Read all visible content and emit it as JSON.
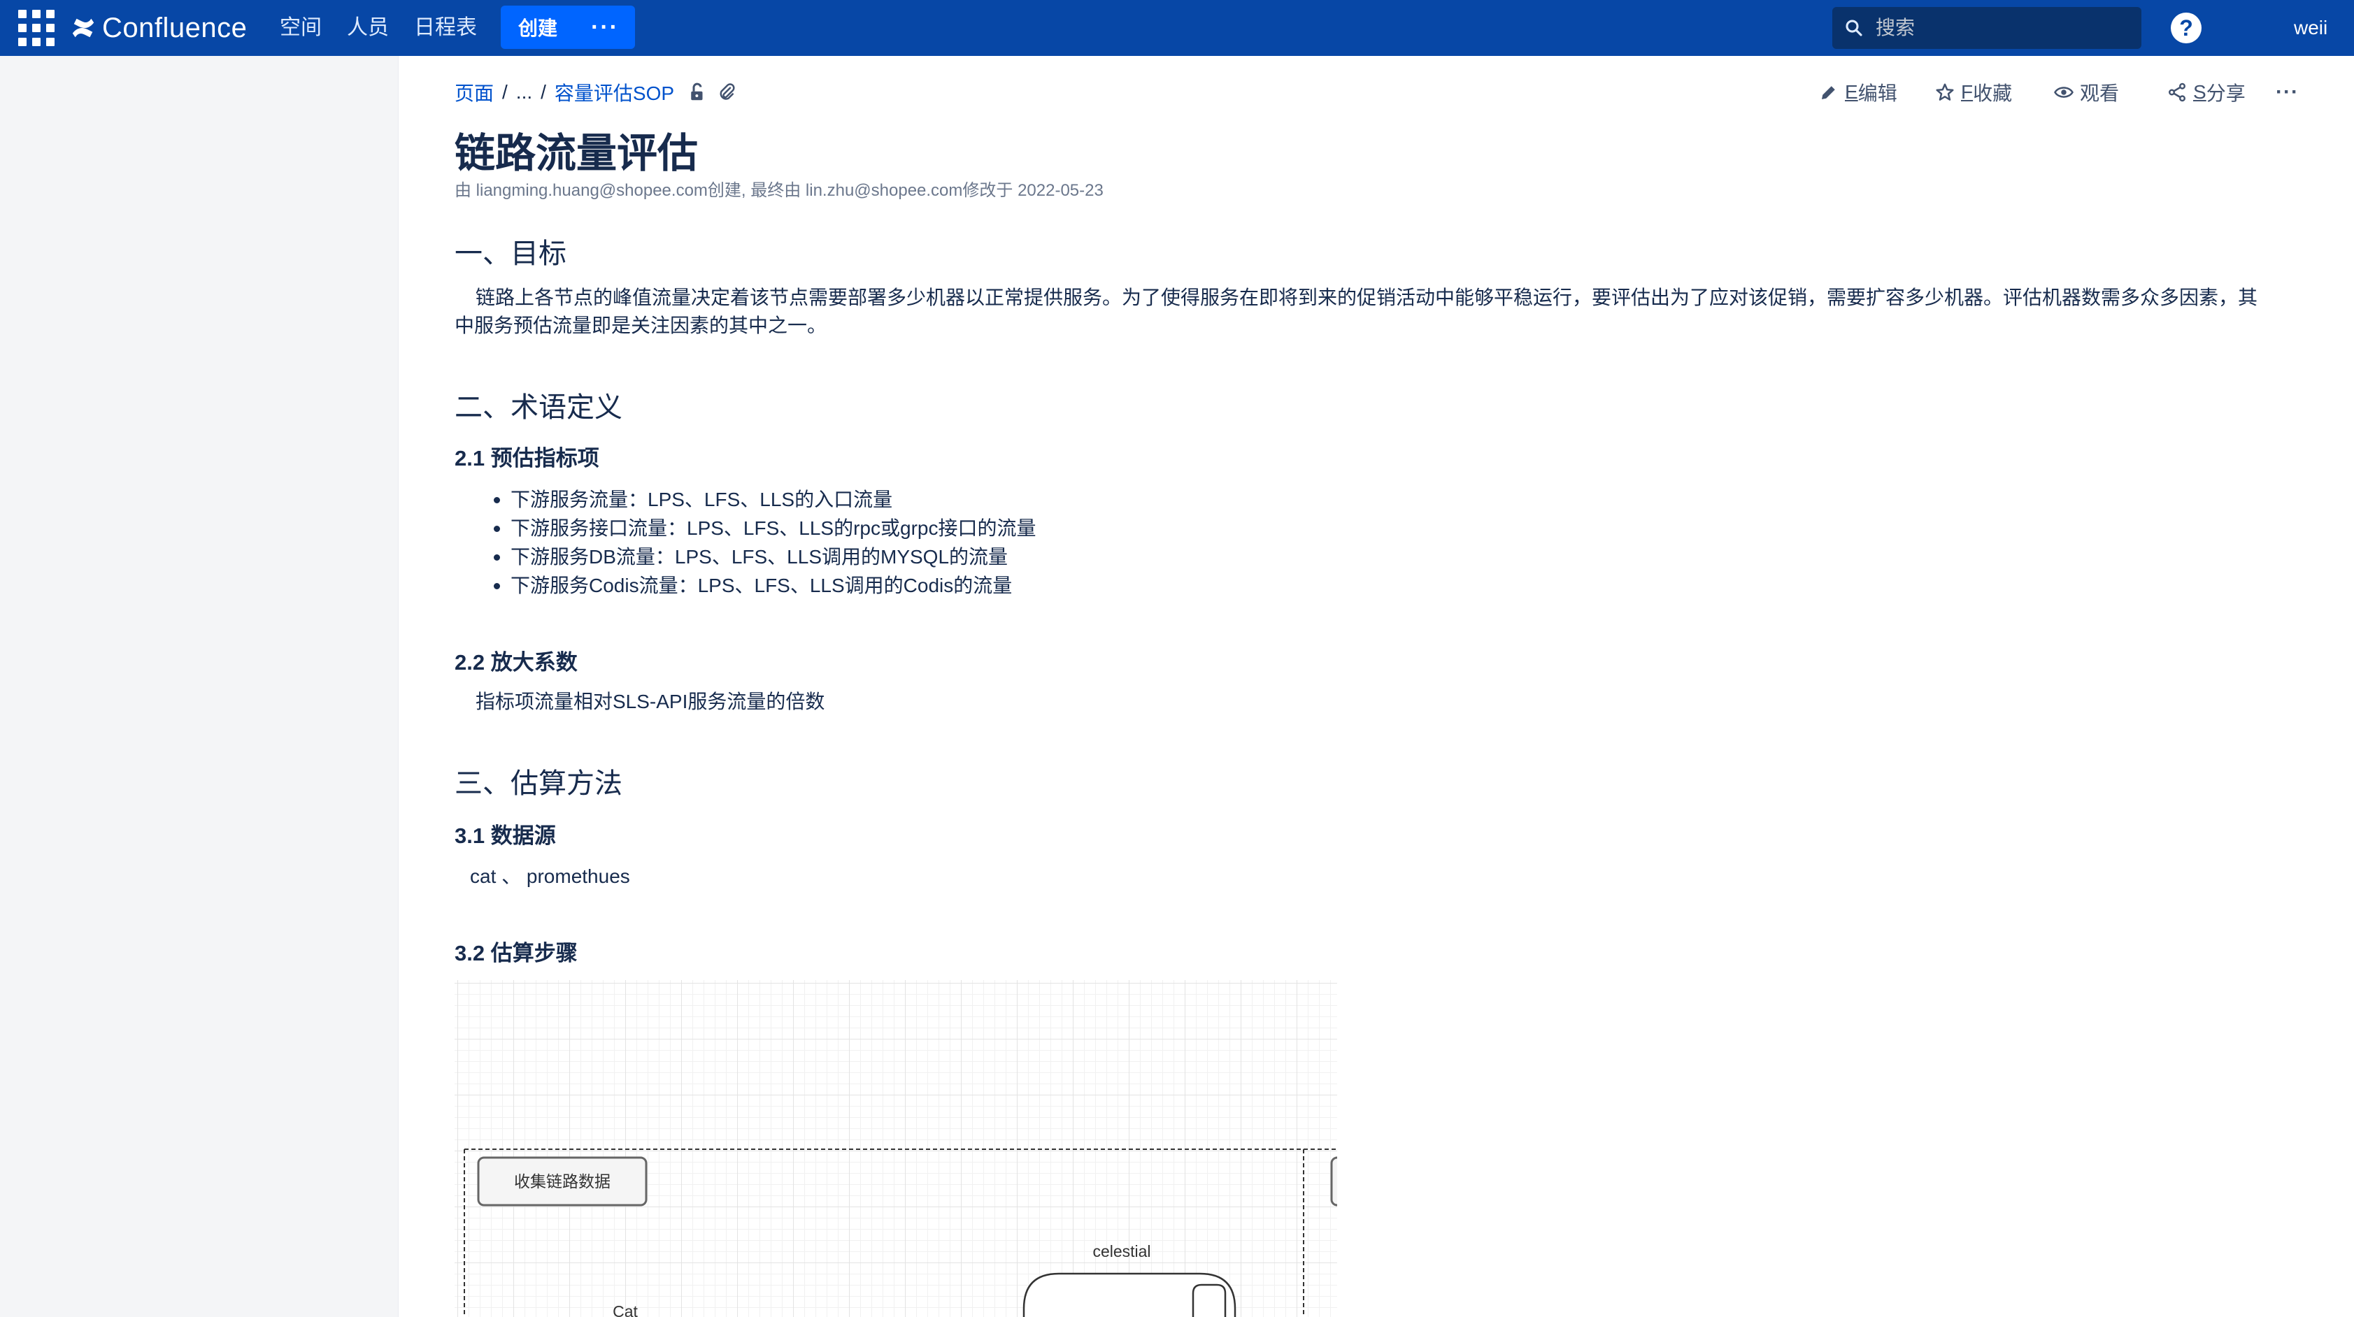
{
  "topnav": {
    "logo_text": "Confluence",
    "nav_items": [
      "空间",
      "人员",
      "日程表"
    ],
    "create_label": "创建",
    "more_label": "···",
    "search_placeholder": "搜索",
    "help_label": "?",
    "user_name": "weii"
  },
  "breadcrumb": {
    "root": "页面",
    "ellipsis": "...",
    "parent": "容量评估SOP"
  },
  "actions": {
    "edit_key": "E",
    "edit_label": "编辑",
    "favorite_key": "F",
    "favorite_label": "收藏",
    "watch_label": "观看",
    "share_key": "S",
    "share_label": "分享",
    "more_label": "···"
  },
  "page": {
    "title": "链路流量评估",
    "byline": "由 liangming.huang@shopee.com创建, 最终由 lin.zhu@shopee.com修改于 2022-05-23"
  },
  "sections": {
    "goal_heading": "一、目标",
    "goal_text": "链路上各节点的峰值流量决定着该节点需要部署多少机器以正常提供服务。为了使得服务在即将到来的促销活动中能够平稳运行，要评估出为了应对该促销，需要扩容多少机器。评估机器数需多众多因素，其中服务预估流量即是关注因素的其中之一。",
    "terms_heading": "二、术语定义",
    "terms_sub1": "2.1 预估指标项",
    "terms_bullets": [
      "下游服务流量：LPS、LFS、LLS的入口流量",
      "下游服务接口流量：LPS、LFS、LLS的rpc或grpc接口的流量",
      "下游服务DB流量：LPS、LFS、LLS调用的MYSQL的流量",
      "下游服务Codis流量：LPS、LFS、LLS调用的Codis的流量"
    ],
    "terms_sub2": "2.2 放大系数",
    "terms_sub2_text": "指标项流量相对SLS-API服务流量的倍数",
    "method_heading": "三、估算方法",
    "method_sub1": "3.1 数据源",
    "method_sub1_text": "cat 、 promethues",
    "method_sub2": "3.2 估算步骤"
  },
  "diagram": {
    "collect_node": "收集链路数据",
    "celestial_label": "celestial",
    "cat_label": "Cat"
  },
  "colors": {
    "nav_bg": "#0747a6",
    "create_btn": "#0065ff",
    "link": "#0052cc",
    "text": "#172b4d",
    "sidebar_bg": "#f4f5f7"
  }
}
